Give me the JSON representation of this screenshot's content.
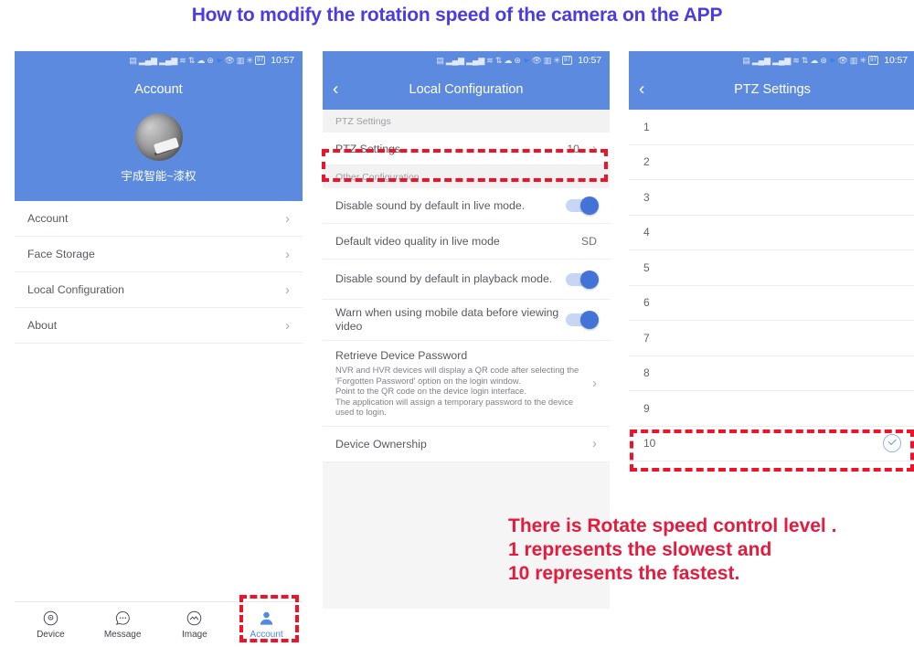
{
  "title": "How to modify the rotation speed of the camera on the APP",
  "colors": {
    "title_purple": "#4b3ce0",
    "header_blue": "#5c8ade",
    "annotation_red": "#e41b3d",
    "highlight_red": "#ef1228",
    "accent_blue": "#4f86e0"
  },
  "status_bar": {
    "time": "10:57",
    "battery": "97",
    "icons": [
      "sim-cards-icon",
      "signal-1-icon",
      "signal-2-icon",
      "wifi-icon",
      "sync-icon",
      "cloud-icon",
      "dnd-icon",
      "location-icon",
      "eye-icon",
      "vibrate-icon",
      "bluetooth-icon"
    ]
  },
  "phone1": {
    "nav_title": "Account",
    "profile_name": "宇成智能~漆权",
    "rows": [
      {
        "label": "Account"
      },
      {
        "label": "Face Storage"
      },
      {
        "label": "Local Configuration"
      },
      {
        "label": "About"
      }
    ],
    "tabs": [
      {
        "label": "Device",
        "icon": "device-camera-icon",
        "active": false
      },
      {
        "label": "Message",
        "icon": "message-bubble-icon",
        "active": false
      },
      {
        "label": "Image",
        "icon": "image-picture-icon",
        "active": false
      },
      {
        "label": "Account",
        "icon": "account-person-icon",
        "active": true
      }
    ]
  },
  "phone2": {
    "nav_title": "Local Configuration",
    "back_icon": "chevron-left-icon",
    "section1": "PTZ Settings",
    "ptz_row": {
      "label": "PTZ Settings",
      "value": "10"
    },
    "section2": "Other Configuration",
    "rows": [
      {
        "label": "Disable sound by default in live mode.",
        "control": "toggle",
        "on": true
      },
      {
        "label": "Default video quality in live mode",
        "control": "value",
        "value": "SD"
      },
      {
        "label": "Disable sound by default in playback mode.",
        "control": "toggle",
        "on": true
      },
      {
        "label": "Warn when using mobile data before viewing video",
        "control": "toggle",
        "on": true
      }
    ],
    "retrieve": {
      "title": "Retrieve Device Password",
      "body": "NVR and HVR devices will display a QR code after selecting the 'Forgotten Password' option on the login window.\nPoint to the QR code on the device login interface.\nThe application will assign a temporary password to the device used to login."
    },
    "ownership": {
      "label": "Device Ownership"
    }
  },
  "phone3": {
    "nav_title": "PTZ Settings",
    "back_icon": "chevron-left-icon",
    "levels": [
      {
        "num": "1",
        "selected": false
      },
      {
        "num": "2",
        "selected": false
      },
      {
        "num": "3",
        "selected": false
      },
      {
        "num": "4",
        "selected": false
      },
      {
        "num": "5",
        "selected": false
      },
      {
        "num": "6",
        "selected": false
      },
      {
        "num": "7",
        "selected": false
      },
      {
        "num": "8",
        "selected": false
      },
      {
        "num": "9",
        "selected": false
      },
      {
        "num": "10",
        "selected": true
      }
    ]
  },
  "annotation": "There is Rotate speed control level .\n1 represents the slowest and\n10 represents the fastest."
}
